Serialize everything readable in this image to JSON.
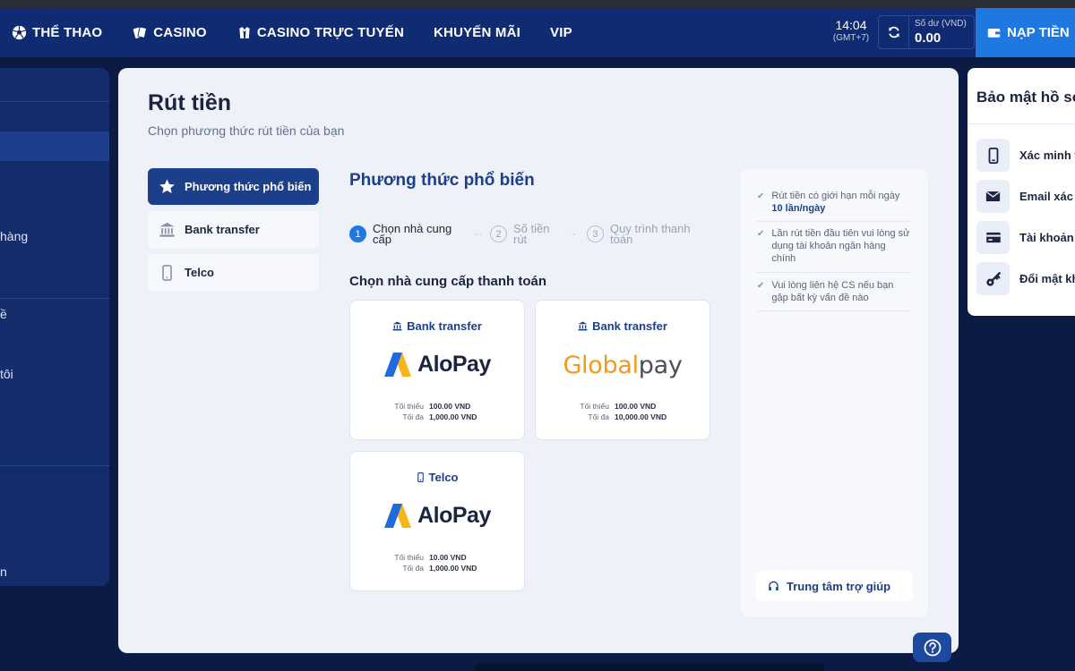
{
  "topbar": {
    "nav": [
      {
        "label": "THỂ THAO",
        "icon": "soccer-ball-icon"
      },
      {
        "label": "CASINO",
        "icon": "cards-icon"
      },
      {
        "label": "CASINO TRỰC TUYẾN",
        "icon": "dealer-icon"
      },
      {
        "label": "KHUYẾN MÃI",
        "icon": ""
      },
      {
        "label": "VIP",
        "icon": ""
      }
    ],
    "time": "14:04",
    "timezone": "(GMT+7)",
    "balance_label": "Số dư (VND)",
    "balance_value": "0.00",
    "deposit_label": "NẠP TIỀN"
  },
  "left_panel": {
    "items": [
      "hàng",
      "ề",
      "tôi",
      "n"
    ]
  },
  "main": {
    "title": "Rút tiền",
    "subtitle": "Chọn phương thức rút tiền của bạn",
    "methods": [
      {
        "label": "Phương thức phổ biến",
        "icon": "star-icon",
        "active": true
      },
      {
        "label": "Bank transfer",
        "icon": "bank-icon",
        "active": false
      },
      {
        "label": "Telco",
        "icon": "phone-icon",
        "active": false
      }
    ],
    "section_title": "Phương thức phổ biến",
    "steps": [
      {
        "num": "1",
        "line1": "Chọn nhà cung",
        "line2": "cấp",
        "active": true
      },
      {
        "num": "2",
        "line1": "Số tiền",
        "line2": "rút",
        "active": false
      },
      {
        "num": "3",
        "line1": "Quy trình thanh",
        "line2": "toán",
        "active": false
      }
    ],
    "provider_title": "Chọn nhà cung cấp thanh toán",
    "providers": [
      {
        "tag": "Bank transfer",
        "tag_icon": "bank-icon",
        "logo": "AloPay",
        "min_label": "Tối thiểu",
        "min": "100.00  VND",
        "max_label": "Tối đa",
        "max": "1,000.00  VND"
      },
      {
        "tag": "Bank transfer",
        "tag_icon": "bank-icon",
        "logo_a": "Global",
        "logo_b": "pay",
        "min_label": "Tối thiểu",
        "min": "100.00  VND",
        "max_label": "Tối đa",
        "max": "10,000.00  VND"
      },
      {
        "tag": "Telco",
        "tag_icon": "phone-icon",
        "logo": "AloPay",
        "min_label": "Tối thiểu",
        "min": "10.00  VND",
        "max_label": "Tối đa",
        "max": "1,000.00  VND"
      }
    ],
    "notes": {
      "n1_text": "Rút tiền có giới hạn mỗi ngày",
      "n1_bold": "10 lần/ngày",
      "n2": "Lần rút tiền đầu tiên vui lòng sử dụng tài khoản ngân hàng chính",
      "n3": "Vui lòng liên hệ CS nếu bạn gặp bất kỳ vấn đề nào",
      "help": "Trung tâm trợ giúp"
    }
  },
  "right_panel": {
    "title": "Bảo mật hồ sơ",
    "items": [
      {
        "label": "Xác minh t",
        "icon": "mobile-icon"
      },
      {
        "label": "Email xác t",
        "icon": "mail-icon"
      },
      {
        "label": "Tài khoản",
        "icon": "card-icon"
      },
      {
        "label": "Đổi mật kh",
        "icon": "key-icon"
      }
    ]
  },
  "colors": {
    "topbar": "#0f2b72",
    "accent": "#1e78e0",
    "primary": "#1c3f8c",
    "background": "#0b1b44"
  }
}
